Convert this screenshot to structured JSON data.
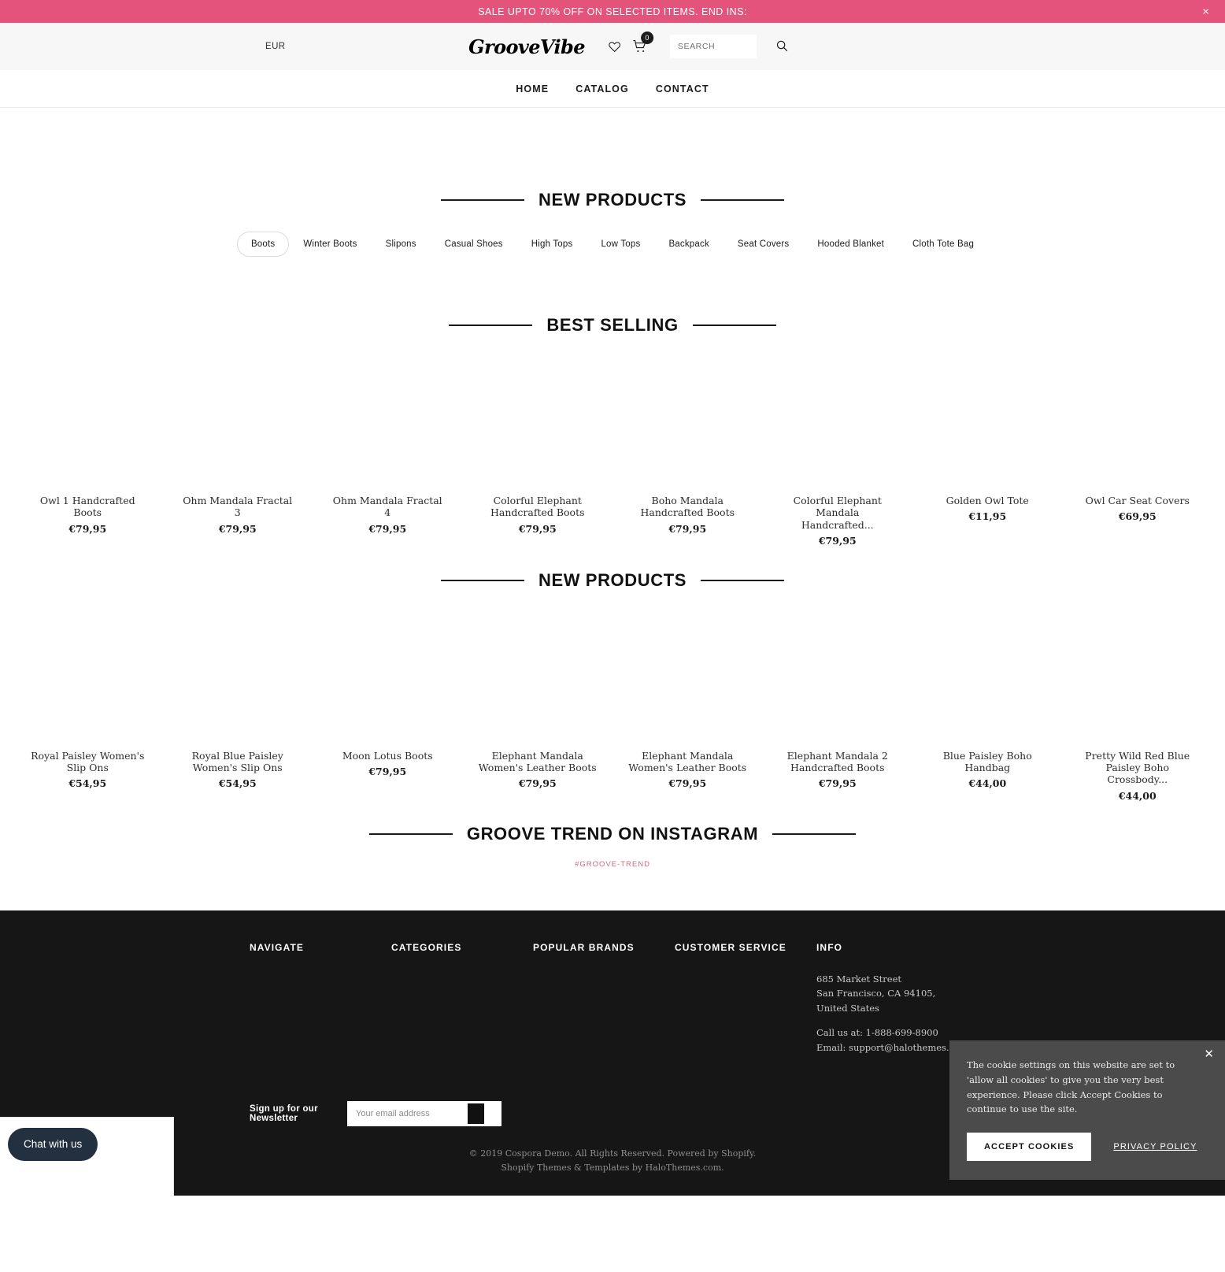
{
  "announcement": {
    "text": "SALE UPTO 70% OFF ON SELECTED ITEMS. END INS:",
    "close_label": "×",
    "background": "#e4537a"
  },
  "header": {
    "currency": "EUR",
    "logo": "GrooveVibe",
    "wishlist_icon": "heart-icon",
    "cart_icon": "cart-icon",
    "cart_count": "0",
    "search_placeholder": "SEARCH",
    "search_value": "",
    "search_icon": "search-icon"
  },
  "nav": {
    "items": [
      {
        "label": "HOME"
      },
      {
        "label": "CATALOG"
      },
      {
        "label": "CONTACT"
      }
    ]
  },
  "new_products_tabs": {
    "heading": "NEW PRODUCTS",
    "tabs": [
      {
        "label": "Boots",
        "active": true
      },
      {
        "label": "Winter Boots",
        "active": false
      },
      {
        "label": "Slipons",
        "active": false
      },
      {
        "label": "Casual Shoes",
        "active": false
      },
      {
        "label": "High Tops",
        "active": false
      },
      {
        "label": "Low Tops",
        "active": false
      },
      {
        "label": "Backpack",
        "active": false
      },
      {
        "label": "Seat Covers",
        "active": false
      },
      {
        "label": "Hooded Blanket",
        "active": false
      },
      {
        "label": "Cloth Tote Bag",
        "active": false
      }
    ]
  },
  "best_selling": {
    "heading": "BEST SELLING",
    "products": [
      {
        "title": "Owl 1 Handcrafted Boots",
        "price": "€79,95"
      },
      {
        "title": "Ohm Mandala Fractal 3",
        "price": "€79,95"
      },
      {
        "title": "Ohm Mandala Fractal 4",
        "price": "€79,95"
      },
      {
        "title": "Colorful Elephant Handcrafted Boots",
        "price": "€79,95"
      },
      {
        "title": "Boho Mandala Handcrafted Boots",
        "price": "€79,95"
      },
      {
        "title": "Colorful Elephant Mandala Handcrafted...",
        "price": "€79,95"
      },
      {
        "title": "Golden Owl Tote",
        "price": "€11,95"
      },
      {
        "title": "Owl Car Seat Covers",
        "price": "€69,95"
      }
    ]
  },
  "new_products": {
    "heading": "NEW PRODUCTS",
    "products": [
      {
        "title": "Royal Paisley Women's Slip Ons",
        "price": "€54,95"
      },
      {
        "title": "Royal Blue Paisley Women's Slip Ons",
        "price": "€54,95"
      },
      {
        "title": "Moon Lotus Boots",
        "price": "€79,95"
      },
      {
        "title": "Elephant Mandala Women's Leather Boots",
        "price": "€79,95"
      },
      {
        "title": "Elephant Mandala Women's Leather Boots",
        "price": "€79,95"
      },
      {
        "title": "Elephant Mandala 2 Handcrafted Boots",
        "price": "€79,95"
      },
      {
        "title": "Blue Paisley Boho Handbag",
        "price": "€44,00"
      },
      {
        "title": "Pretty Wild Red Blue Paisley Boho Crossbody...",
        "price": "€44,00"
      }
    ]
  },
  "instagram": {
    "heading": "GROOVE TREND ON INSTAGRAM",
    "hashtag": "#GROOVE-TREND",
    "hashtag_color": "#d06a7e"
  },
  "footer": {
    "columns": [
      {
        "title": "NAVIGATE"
      },
      {
        "title": "CATEGORIES"
      },
      {
        "title": "POPULAR BRANDS"
      },
      {
        "title": "CUSTOMER SERVICE"
      }
    ],
    "info": {
      "title": "INFO",
      "address_line1": "685 Market Street",
      "address_line2": "San Francisco, CA 94105,",
      "address_line3": "United States",
      "phone": "Call us at: 1-888-699-8900",
      "email": "Email: support@halothemes.com"
    },
    "newsletter": {
      "label": "Sign up for our Newsletter",
      "placeholder": "Your email address",
      "value": "",
      "submit_icon": "submit-arrow-icon"
    },
    "copyright_line1": "© 2019 Cospora Demo. All Rights Reserved. Powered by Shopify.",
    "copyright_line2": "Shopify Themes & Templates by HaloThemes.com."
  },
  "chat": {
    "label": "Chat with us"
  },
  "cookie": {
    "text": "The cookie settings on this website are set to 'allow all cookies' to give you the very best experience. Please click Accept Cookies to continue to use the site.",
    "accept_label": "ACCEPT COOKIES",
    "privacy_label": "PRIVACY POLICY",
    "close_label": "✕"
  }
}
